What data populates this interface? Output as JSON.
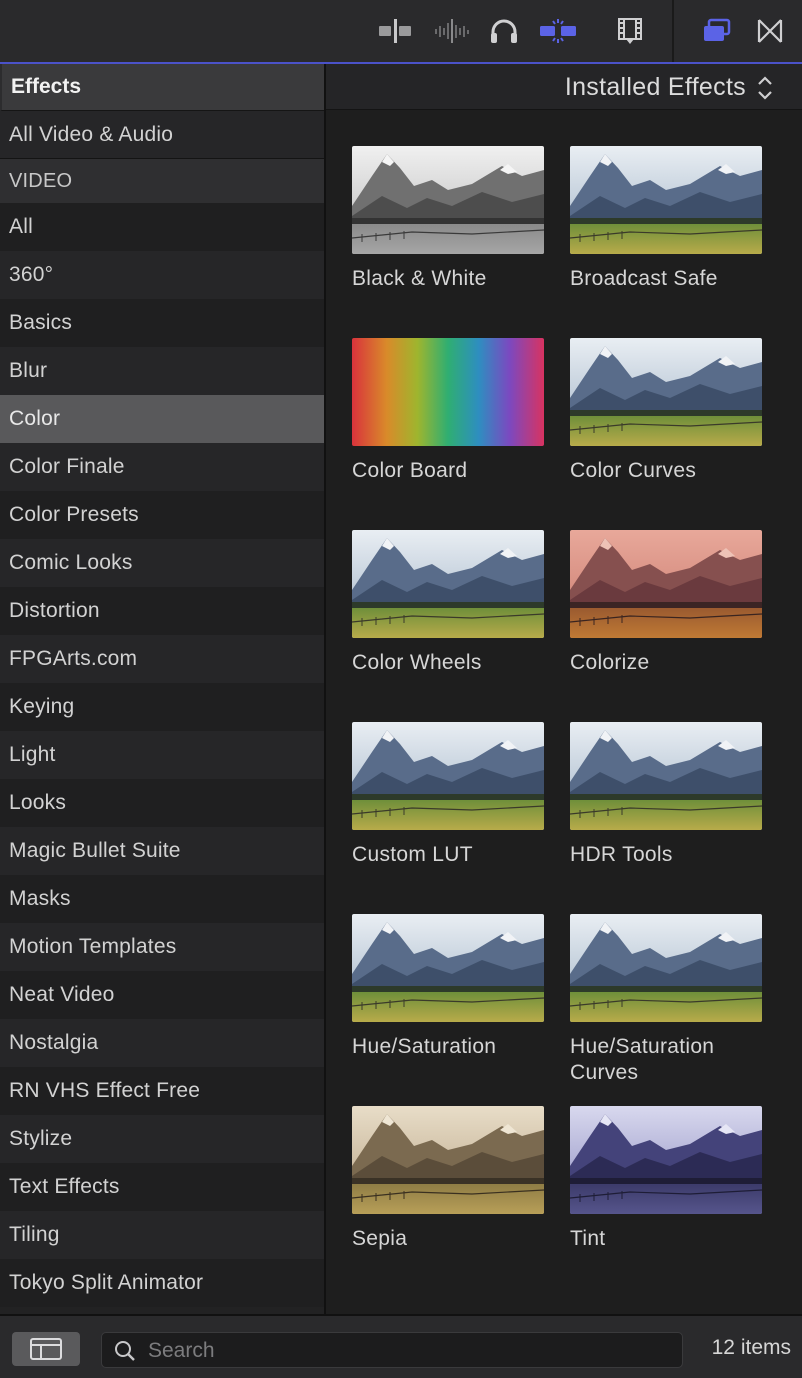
{
  "toolbar": {
    "icons": [
      "clip-skimming-icon",
      "audio-skimming-icon",
      "headphones-icon",
      "snapping-icon",
      "filmstrip-icon",
      "browser-toggle-icon",
      "transitions-icon"
    ],
    "accent": "#5b63e6"
  },
  "sidebar": {
    "header": "Effects",
    "all_label": "All Video & Audio",
    "section_label": "VIDEO",
    "items": [
      "All",
      "360°",
      "Basics",
      "Blur",
      "Color",
      "Color Finale",
      "Color Presets",
      "Comic Looks",
      "Distortion",
      "FPGArts.com",
      "Keying",
      "Light",
      "Looks",
      "Magic Bullet Suite",
      "Masks",
      "Motion Templates",
      "Neat Video",
      "Nostalgia",
      "RN VHS Effect Free",
      "Stylize",
      "Text Effects",
      "Tiling",
      "Tokyo Split Animator"
    ],
    "selected": "Color"
  },
  "content": {
    "header": "Installed Effects",
    "effects": [
      {
        "name": "Black & White",
        "style": "bw"
      },
      {
        "name": "Broadcast Safe",
        "style": "normal"
      },
      {
        "name": "Color Board",
        "style": "rainbow"
      },
      {
        "name": "Color Curves",
        "style": "normal"
      },
      {
        "name": "Color Wheels",
        "style": "normal"
      },
      {
        "name": "Colorize",
        "style": "colorize"
      },
      {
        "name": "Custom LUT",
        "style": "normal"
      },
      {
        "name": "HDR Tools",
        "style": "normal"
      },
      {
        "name": "Hue/Saturation",
        "style": "normal"
      },
      {
        "name": "Hue/Saturation Curves",
        "style": "normal"
      },
      {
        "name": "Sepia",
        "style": "sepia"
      },
      {
        "name": "Tint",
        "style": "tint"
      }
    ]
  },
  "bottom": {
    "search_placeholder": "Search",
    "item_count": "12 items"
  }
}
